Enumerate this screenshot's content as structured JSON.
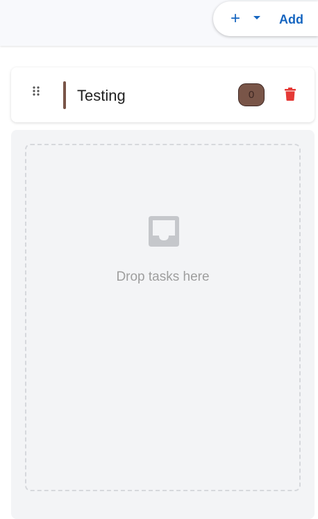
{
  "toolbar": {
    "plus_glyph": "+",
    "add_label": "Add",
    "accent_color": "#1565c0"
  },
  "column": {
    "title": "Testing",
    "count": "0",
    "color": "#795548",
    "empty_state": {
      "icon": "inbox-icon",
      "text": "Drop tasks here"
    },
    "delete_color": "#e53935"
  }
}
